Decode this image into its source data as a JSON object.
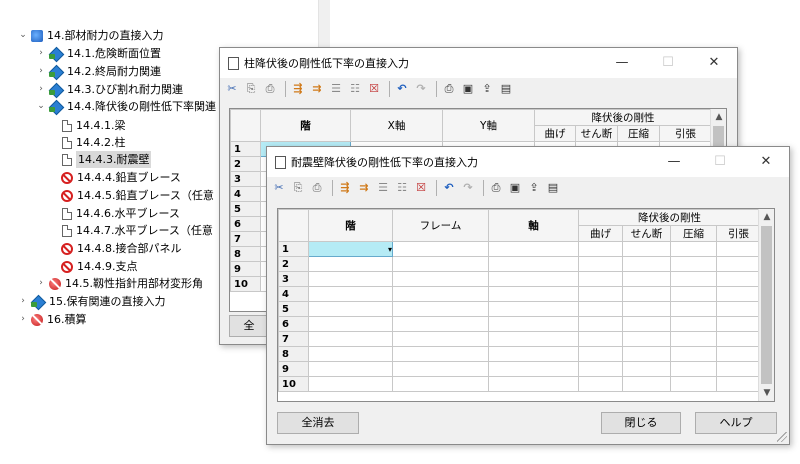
{
  "tree": {
    "items": [
      {
        "label": "14.部材耐力の直接入力",
        "icon": "globe-icon"
      },
      {
        "label": "14.1.危険断面位置",
        "icon": "diamond-icon"
      },
      {
        "label": "14.2.終局耐力関連",
        "icon": "diamond-icon"
      },
      {
        "label": "14.3.ひび割れ耐力関連",
        "icon": "diamond-icon"
      },
      {
        "label": "14.4.降伏後の剛性低下率関連",
        "icon": "diamond-icon"
      },
      {
        "label": "14.4.1.梁",
        "icon": "document-icon"
      },
      {
        "label": "14.4.2.柱",
        "icon": "document-icon"
      },
      {
        "label": "14.4.3.耐震壁",
        "icon": "document-icon"
      },
      {
        "label": "14.4.4.鉛直ブレース",
        "icon": "no-entry-icon"
      },
      {
        "label": "14.4.5.鉛直ブレース（任意",
        "icon": "no-entry-icon"
      },
      {
        "label": "14.4.6.水平ブレース",
        "icon": "document-icon"
      },
      {
        "label": "14.4.7.水平ブレース（任意",
        "icon": "document-icon"
      },
      {
        "label": "14.4.8.接合部パネル",
        "icon": "no-entry-icon"
      },
      {
        "label": "14.4.9.支点",
        "icon": "no-entry-icon"
      },
      {
        "label": "14.5.靱性指針用部材変形角",
        "icon": "globe-red-icon"
      },
      {
        "label": "15.保有関連の直接入力",
        "icon": "diamond-icon"
      },
      {
        "label": "16.積算",
        "icon": "globe-red-icon"
      }
    ]
  },
  "win_back": {
    "title": "柱降伏後の剛性低下率の直接入力",
    "headers": {
      "floor": "階",
      "x_axis": "X軸",
      "y_axis": "Y軸",
      "group": "降伏後の剛性",
      "bend": "曲げ",
      "shear": "せん断",
      "compress": "圧縮",
      "tension": "引張"
    },
    "rows": [
      "1",
      "2",
      "3",
      "4",
      "5",
      "6",
      "7",
      "8",
      "9",
      "10"
    ],
    "clear_all_partial": "全"
  },
  "win_front": {
    "title": "耐震壁降伏後の剛性低下率の直接入力",
    "headers": {
      "floor": "階",
      "frame": "フレーム",
      "axis": "軸",
      "group": "降伏後の剛性",
      "bend": "曲げ",
      "shear": "せん断",
      "compress": "圧縮",
      "tension": "引張"
    },
    "rows": [
      "1",
      "2",
      "3",
      "4",
      "5",
      "6",
      "7",
      "8",
      "9",
      "10"
    ],
    "dropdown_arrow": "▾",
    "buttons": {
      "clear_all": "全消去",
      "close": "閉じる",
      "help": "ヘルプ"
    }
  },
  "window_controls": {
    "minimize": "—",
    "maximize": "☐",
    "close": "✕"
  },
  "scroll": {
    "up": "▲",
    "down": "▼"
  },
  "toolbar_glyphs": {
    "cut": "✂",
    "copy": "⎘",
    "paste": "⎙",
    "insert1": "⇶",
    "insert2": "⇉",
    "delete1": "☰",
    "delete2": "☷",
    "delete3": "☒",
    "undo": "↶",
    "redo": "↷",
    "print": "⎙",
    "preview": "▣",
    "export": "⇪",
    "misc": "▤"
  }
}
